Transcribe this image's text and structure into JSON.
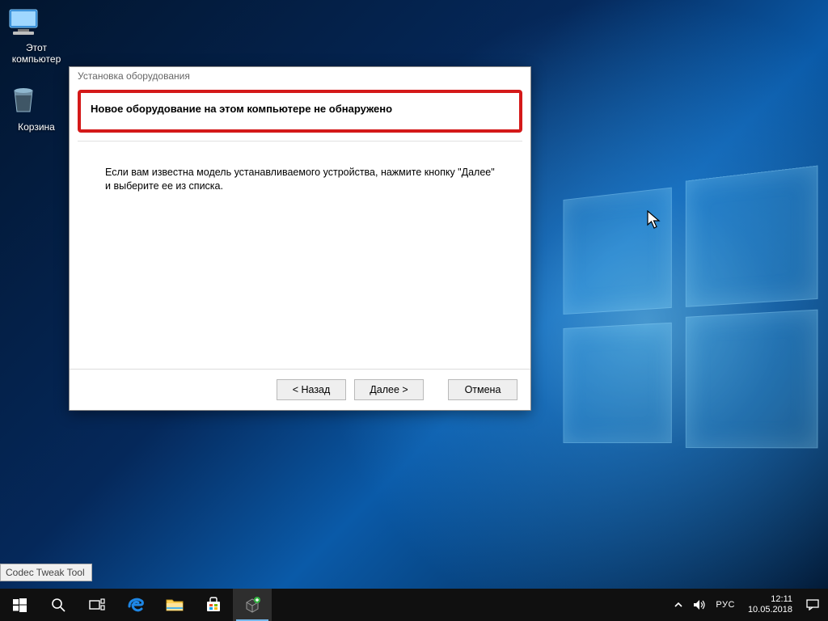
{
  "desktop": {
    "icons": {
      "this_pc": {
        "label": "Этот\nкомпьютер"
      },
      "recycle": {
        "label": "Корзина"
      }
    },
    "tooltip": "Codec Tweak Tool"
  },
  "wizard": {
    "title": "Установка оборудования",
    "headline": "Новое оборудование на этом компьютере не обнаружено",
    "body": "Если вам известна модель устанавливаемого устройства, нажмите кнопку \"Далее\" и выберите ее из списка.",
    "buttons": {
      "back": "< Назад",
      "next": "Далее >",
      "cancel": "Отмена"
    }
  },
  "taskbar": {
    "items": {
      "start": "start-menu",
      "search": "search",
      "taskview": "task-view",
      "edge": "edge-browser",
      "explorer": "file-explorer",
      "store": "microsoft-store",
      "codec": "codec-tweak-tool"
    }
  },
  "tray": {
    "lang": "РУС",
    "time": "12:11",
    "date": "10.05.2018"
  },
  "highlight_color": "#d41919"
}
